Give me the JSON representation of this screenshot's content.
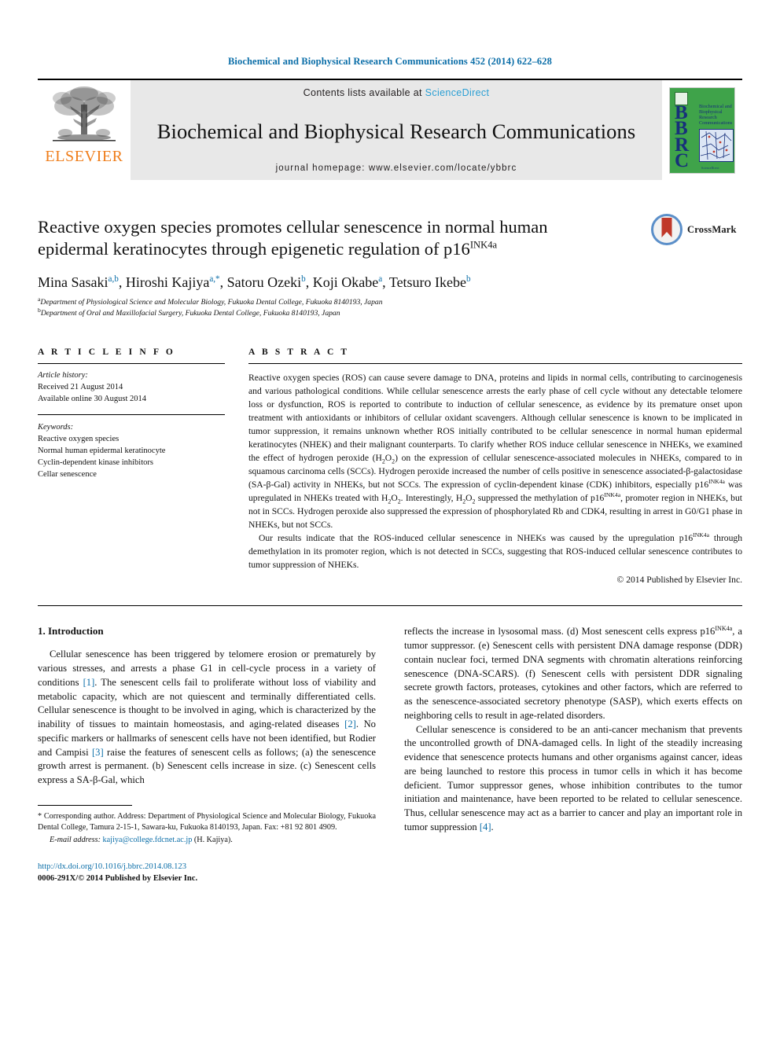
{
  "running_head": "Biochemical and Biophysical Research Communications 452 (2014) 622–628",
  "masthead": {
    "publisher": "ELSEVIER",
    "contents_prefix": "Contents lists available at ",
    "contents_link": "ScienceDirect",
    "journal_title": "Biochemical and Biophysical Research Communications",
    "homepage": "journal homepage: www.elsevier.com/locate/ybbrc",
    "cover": {
      "letters": "BBRC",
      "title": "Biochemical and Biophysical Research Communications",
      "footer": "ScienceDirect"
    }
  },
  "article": {
    "title_line1": "Reactive oxygen species promotes cellular senescence in normal human",
    "title_line2_pre": "epidermal keratinocytes through epigenetic regulation of p16",
    "title_superscript": "INK4a",
    "crossmark_label": "CrossMark",
    "authors": [
      {
        "name": "Mina Sasaki",
        "sup": "a,b",
        "sep": ", "
      },
      {
        "name": "Hiroshi Kajiya",
        "sup": "a,*",
        "sep": ", "
      },
      {
        "name": "Satoru Ozeki",
        "sup": "b",
        "sep": ", "
      },
      {
        "name": "Koji Okabe",
        "sup": "a",
        "sep": ", "
      },
      {
        "name": "Tetsuro Ikebe",
        "sup": "b",
        "sep": ""
      }
    ],
    "affiliations": [
      {
        "mark": "a",
        "text": "Department of Physiological Science and Molecular Biology, Fukuoka Dental College, Fukuoka 8140193, Japan"
      },
      {
        "mark": "b",
        "text": "Department of Oral and Maxillofacial Surgery, Fukuoka Dental College, Fukuoka 8140193, Japan"
      }
    ]
  },
  "article_info": {
    "heading": "A R T I C L E   I N F O",
    "history_label": "Article history:",
    "history": [
      "Received 21 August 2014",
      "Available online 30 August 2014"
    ],
    "keywords_label": "Keywords:",
    "keywords": [
      "Reactive oxygen species",
      "Normal human epidermal keratinocyte",
      "Cyclin-dependent kinase inhibitors",
      "Cellar senescence"
    ]
  },
  "abstract": {
    "heading": "A B S T R A C T",
    "paragraph1_a": "Reactive oxygen species (ROS) can cause severe damage to DNA, proteins and lipids in normal cells, contributing to carcinogenesis and various pathological conditions. While cellular senescence arrests the early phase of cell cycle without any detectable telomere loss or dysfunction, ROS is reported to contribute to induction of cellular senescence, as evidence by its premature onset upon treatment with antioxidants or inhibitors of cellular oxidant scavengers. Although cellular senescence is known to be implicated in tumor suppression, it remains unknown whether ROS initially contributed to be cellular senescence in normal human epidermal keratinocytes (NHEK) and their malignant counterparts. To clarify whether ROS induce cellular senescence in NHEKs, we examined the effect of hydrogen peroxide (H",
    "p1_sub1": "2",
    "p1_b": "O",
    "p1_sub2": "2",
    "p1_c": ") on the expression of cellular senescence-associated molecules in NHEKs, compared to in squamous carcinoma cells (SCCs). Hydrogen peroxide increased the number of cells positive in senescence associated-β-galactosidase (SA-β-Gal) activity in NHEKs, but not SCCs. The expression of cyclin-dependent kinase (CDK) inhibitors, especially p16",
    "p1_sup1": "INK4a",
    "p1_d": " was upregulated in NHEKs treated with H",
    "p1_sub3": "2",
    "p1_e": "O",
    "p1_sub4": "2",
    "p1_f": ". Interestingly, H",
    "p1_sub5": "2",
    "p1_g": "O",
    "p1_sub6": "2",
    "p1_h": " suppressed the methylation of p16",
    "p1_sup2": "INK4a",
    "p1_i": ", promoter region in NHEKs, but not in SCCs. Hydrogen peroxide also suppressed the expression of phosphorylated Rb and CDK4, resulting in arrest in G0/G1 phase in NHEKs, but not SCCs.",
    "paragraph2_a": "Our results indicate that the ROS-induced cellular senescence in NHEKs was caused by the upregulation p16",
    "p2_sup1": "INK4a",
    "p2_b": " through demethylation in its promoter region, which is not detected in SCCs, suggesting that ROS-induced cellular senescence contributes to tumor suppression of NHEKs.",
    "copyright": "© 2014 Published by Elsevier Inc."
  },
  "introduction": {
    "heading": "1. Introduction",
    "left_p1_a": "Cellular senescence has been triggered by telomere erosion or prematurely by various stresses, and arrests a phase G1 in cell-cycle process in a variety of conditions ",
    "left_ref1": "[1]",
    "left_p1_b": ". The senescent cells fail to proliferate without loss of viability and metabolic capacity, which are not quiescent and terminally differentiated cells. Cellular senescence is thought to be involved in aging, which is characterized by the inability of tissues to maintain homeostasis, and aging-related diseases ",
    "left_ref2": "[2]",
    "left_p1_c": ". No specific markers or hallmarks of senescent cells have not been identified, but Rodier and Campisi ",
    "left_ref3": "[3]",
    "left_p1_d": " raise the features of senescent cells as follows; (a) the senescence growth arrest is permanent. (b) Senescent cells increase in size. (c) Senescent cells express a SA-β-Gal, which",
    "right_p1_a": "reflects the increase in lysosomal mass. (d) Most senescent cells express p16",
    "right_sup1": "INK4a",
    "right_p1_b": ", a tumor suppressor. (e) Senescent cells with persistent DNA damage response (DDR) contain nuclear foci, termed DNA segments with chromatin alterations reinforcing senescence (DNA-SCARS). (f) Senescent cells with persistent DDR signaling secrete growth factors, proteases, cytokines and other factors, which are referred to as the senescence-associated secretory phenotype (SASP), which exerts effects on neighboring cells to result in age-related disorders.",
    "right_p2_a": "Cellular senescence is considered to be an anti-cancer mechanism that prevents the uncontrolled growth of DNA-damaged cells. In light of the steadily increasing evidence that senescence protects humans and other organisms against cancer, ideas are being launched to restore this process in tumor cells in which it has become deficient. Tumor suppressor genes, whose inhibition contributes to the tumor initiation and maintenance, have been reported to be related to cellular senescence. Thus, cellular senescence may act as a barrier to cancer and play an important role in tumor suppression ",
    "right_ref4": "[4]",
    "right_p2_b": "."
  },
  "footnotes": {
    "corresponding": "* Corresponding author. Address: Department of Physiological Science and Molecular Biology, Fukuoka Dental College, Tamura 2-15-1, Sawara-ku, Fukuoka 8140193, Japan. Fax: +81 92 801 4909.",
    "email_label": "E-mail address:",
    "email": "kajiya@college.fdcnet.ac.jp",
    "email_suffix": "(H. Kajiya).",
    "doi": "http://dx.doi.org/10.1016/j.bbrc.2014.08.123",
    "issn": "0006-291X/© 2014 Published by Elsevier Inc."
  },
  "colors": {
    "link_blue": "#0b6ea8",
    "sciencedirect_blue": "#2b9fd4",
    "elsevier_orange": "#ef7d1a",
    "cover_green": "#3fa34a",
    "masthead_gray": "#e8e8e8"
  }
}
